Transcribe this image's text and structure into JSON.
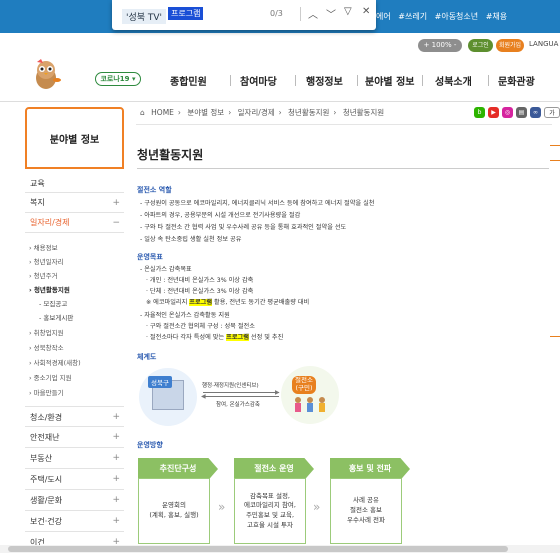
{
  "findbar": {
    "query": "'성북 TV'",
    "highlight": "프로그램",
    "count": "0/3"
  },
  "topbar": {
    "links": [
      "에어",
      "#쓰레기",
      "#아동청소년",
      "#채용"
    ]
  },
  "util": {
    "zoom": "+ 100% -",
    "login": "로그인",
    "join": "회원가입",
    "lang": "LANGUA"
  },
  "corona_btn": "코로나19 ▾",
  "gnb": [
    "종합민원",
    "참여마당",
    "행정정보",
    "분야별 정보",
    "성북소개",
    "문화관광"
  ],
  "sidebar": {
    "title": "분야별 정보",
    "items": [
      {
        "label": "교육",
        "plus": ""
      },
      {
        "label": "복지",
        "plus": "+"
      },
      {
        "label": "일자리/경제",
        "plus": "−"
      },
      {
        "label": "청소/환경",
        "plus": "+"
      },
      {
        "label": "안전재난",
        "plus": "+"
      },
      {
        "label": "부동산",
        "plus": "+"
      },
      {
        "label": "주택/도시",
        "plus": "+"
      },
      {
        "label": "생활/문화",
        "plus": "+"
      },
      {
        "label": "보건·건강",
        "plus": "+"
      },
      {
        "label": "이건",
        "plus": "+"
      }
    ],
    "subs": [
      "채용정보",
      "청년일자리",
      "청년주거",
      "청년활동지원",
      "취창업지원",
      "성북창작소",
      "사회적경제(새창)",
      "중소기업 지원",
      "마을만들기"
    ],
    "subs2": [
      "모집공고",
      "홍보게시판"
    ]
  },
  "breadcrumb": [
    "HOME",
    "분야별 정보",
    "일자리/경제",
    "청년활동지원",
    "청년활동지원"
  ],
  "page_title": "청년활동지원",
  "content": {
    "sec1": "절전소 역할",
    "sec1_lines": [
      "- 구성원이 공동으로 에코마일리지, 에너지클리닉 서비스 등에 참여하고 에너지 절약을 실천",
      "- 아파트의 경우, 공용부문의 시설 개선으로 전기사용량을 절감",
      "- 구와 타 절전소 간 협력 사업 및 우수사례 공유 등을 통해 효과적인 절약을 선도",
      "- 일상 속 탄소중립 생활 실천 정보 공유"
    ],
    "sec2": "운영목표",
    "sec2_lines": [
      "- 온실가스 감축목표",
      "· 개인 : 전년대비 온실가스 3% 이상 감축",
      "· 단체 : 전년대비 온실가스 3% 이상 감축",
      "※ 에코마일리지 ",
      " 활용, 전년도 동기간 평균배출량 대비",
      "- 자율적인 온실가스 감축활동 지원",
      "· 구와 절전소간 협의체 구성 : 성북 절전소",
      "· 절전소마다 각자 특성에 맞는 ",
      " 선정 및 추진"
    ],
    "hl_word": "프로그램",
    "sec3": "체계도",
    "diagram": {
      "left": "성북구",
      "right": "절전소",
      "right_sub": "(구민)",
      "arrow_top": "행정·재정지원(인센티브)",
      "arrow_bottom": "참여, 온실가스감축"
    },
    "sec4": "운영방향",
    "flow": [
      {
        "head": "추진단구성",
        "body": "운영회의\n(계획, 홍보, 실행)"
      },
      {
        "head": "절전소 운영",
        "body": "감축목표 설정,\n에코마일리지 참여,\n주민홍보 및 교육,\n고효율 시설 투자"
      },
      {
        "head": "홍보 및 전파",
        "body": "사례 공유\n절전소 홍보\n우수사례 전파"
      }
    ]
  },
  "icons": [
    "blog",
    "youtube",
    "instagram",
    "print",
    "link",
    "text-size"
  ],
  "colors": {
    "accent": "#e8612c",
    "topbar": "#1f7dbf",
    "green": "#8cc063"
  }
}
